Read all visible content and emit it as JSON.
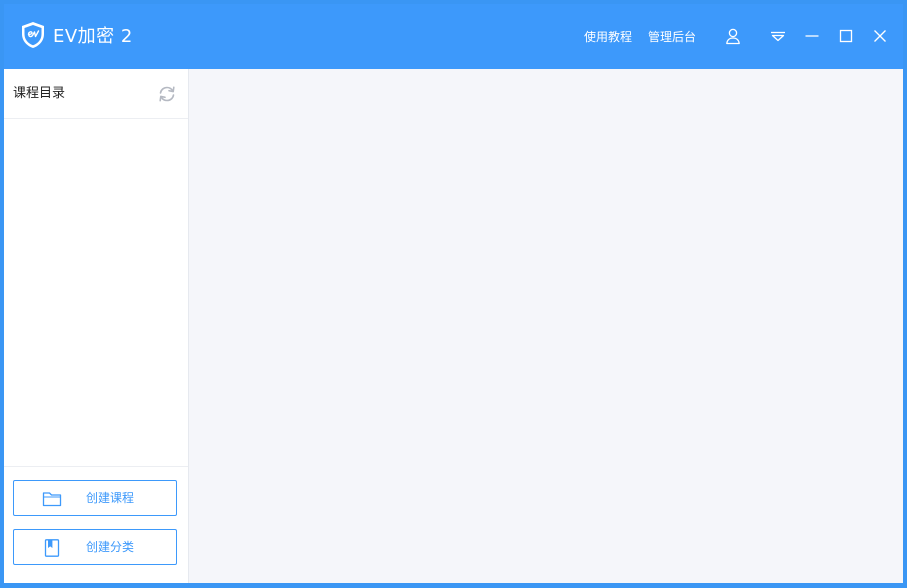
{
  "app": {
    "title": "EV加密 2",
    "accent": "#3d99fb"
  },
  "header": {
    "links": [
      "使用教程",
      "管理后台"
    ],
    "icons": [
      "user-icon",
      "dropdown-menu-icon",
      "minimize-icon",
      "maximize-icon",
      "close-icon"
    ]
  },
  "sidebar": {
    "title": "课程目录",
    "buttons": [
      {
        "label": "创建课程",
        "icon": "folder-icon"
      },
      {
        "label": "创建分类",
        "icon": "book-icon"
      }
    ]
  }
}
